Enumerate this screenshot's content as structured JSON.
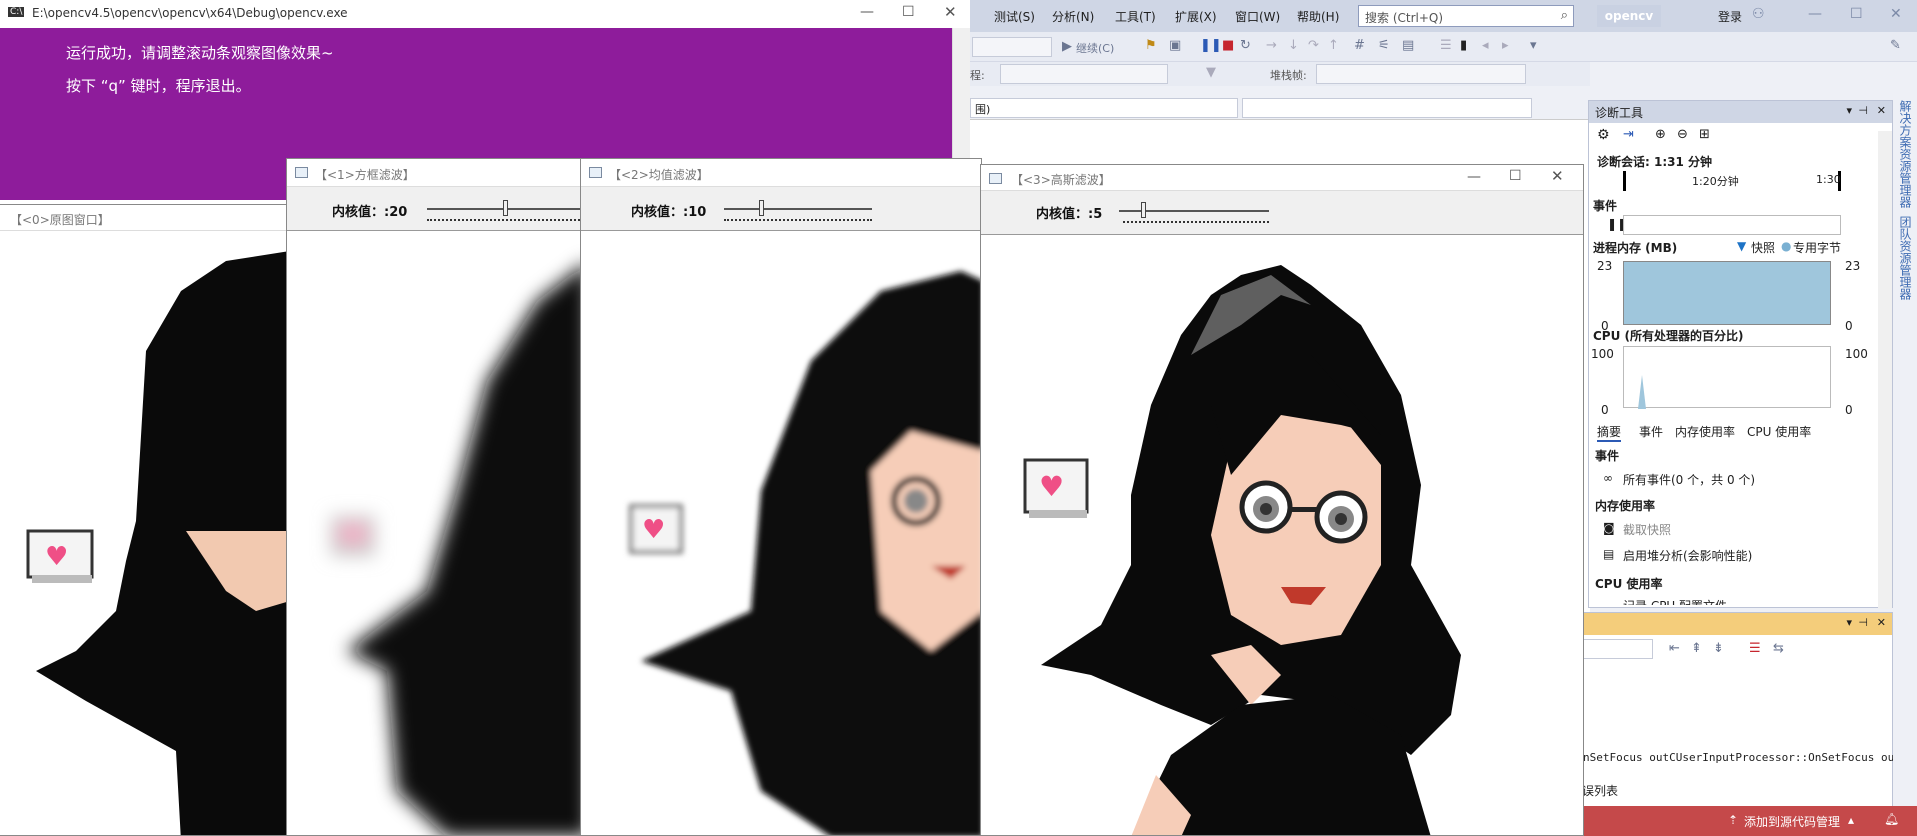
{
  "console": {
    "title": "E:\\opencv4.5\\opencv\\opencv\\x64\\Debug\\opencv.exe",
    "line1": "运行成功，请调整滚动条观察图像效果~",
    "line2": "按下 “q” 键时，程序退出。",
    "icon_text": "C:\\"
  },
  "windows": {
    "original": {
      "title": "【<0>原图窗口】"
    },
    "box": {
      "title": "【<1>方框滤波】",
      "label": "内核值：:20",
      "value": 20
    },
    "mean": {
      "title": "【<2>均值滤波】",
      "label": "内核值：:10",
      "value": 10
    },
    "gauss": {
      "title": "【<3>高斯滤波】",
      "label": "内核值：:5",
      "value": 5
    }
  },
  "vs": {
    "menu": [
      "测试(S)",
      "分析(N)",
      "工具(T)",
      "扩展(X)",
      "窗口(W)",
      "帮助(H)"
    ],
    "search_placeholder": "搜索 (Ctrl+Q)",
    "solution_badge": "opencv",
    "login": "登录",
    "continue_label": "继续(C)",
    "process_label": "程:",
    "stackframe_label": "堆栈帧:",
    "editor_combo": "围)",
    "diag": {
      "title": "诊断工具",
      "session": "诊断会话: 1:31 分钟",
      "tick1": "1:20分钟",
      "tick2": "1:30",
      "events_label": "事件",
      "mem_label": "进程内存 (MB)",
      "legend_snapshot": "快照",
      "legend_private": "专用字节",
      "mem_max_left": "23",
      "mem_max_right": "23",
      "mem_min_left": "0",
      "mem_min_right": "0",
      "cpu_label": "CPU (所有处理器的百分比)",
      "cpu_max_left": "100",
      "cpu_max_right": "100",
      "cpu_min_left": "0",
      "cpu_min_right": "0",
      "tabs": [
        "摘要",
        "事件",
        "内存使用率",
        "CPU 使用率"
      ],
      "sec_events": "事件",
      "all_events": "所有事件(0 个，共 0 个)",
      "sec_memory": "内存使用率",
      "take_snapshot": "截取快照",
      "heap_analysis": "启用堆分析(会影响性能)",
      "sec_cpu": "CPU 使用率",
      "cpu_cut": "记录 CPU 配置文件"
    },
    "output_text": "nSetFocus outCUserInputProcessor::OnSetFocus out",
    "output_list": "误列表",
    "status_add": "添加到源代码管理",
    "side_tab1": "解决方案资源管理器",
    "side_tab2": "团队资源管理器"
  }
}
